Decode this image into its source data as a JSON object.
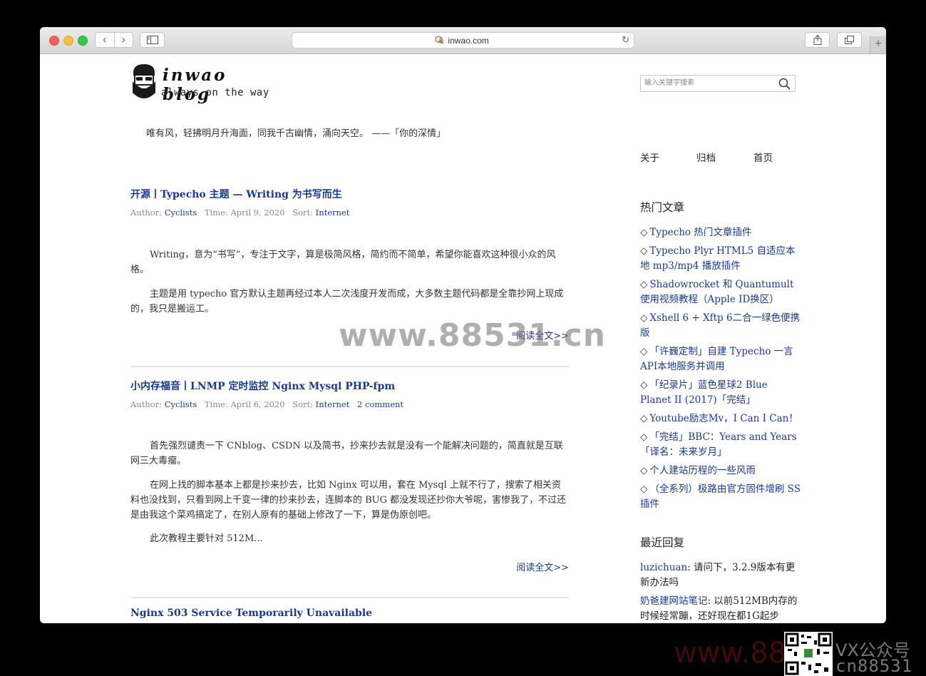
{
  "browser": {
    "url": "inwao.com",
    "back_label": "‹",
    "forward_label": "›",
    "new_tab_label": "+"
  },
  "site": {
    "logo_title": "inwao blog",
    "logo_subtitle": "always on the way",
    "tagline": "唯有风，轻拂明月升海面，同我千古幽情，涌向天空。 ——「你的深情」"
  },
  "posts": [
    {
      "title": "开源丨Typecho 主题 — Writing 为书写而生",
      "author_label": "Author:",
      "author": "Cyclists",
      "time_label": "Time:",
      "time": "April 9, 2020",
      "sort_label": "Sort:",
      "sort": "Internet",
      "paragraphs": [
        "Writing，意为“书写”，专注于文字，算是极简风格，简约而不简单，希望你能喜欢这种很小众的风格。",
        "主题是用 typecho 官方默认主题再经过本人二次浅度开发而成，大多数主题代码都是全靠抄网上现成的，我只是搬运工。"
      ],
      "readmore": "阅读全文>>"
    },
    {
      "title": "小内存福音丨LNMP 定时监控 Nginx Mysql PHP-fpm",
      "author_label": "Author:",
      "author": "Cyclists",
      "time_label": "Time:",
      "time": "April 6, 2020",
      "sort_label": "Sort:",
      "sort": "Internet",
      "comments": "2 comment",
      "paragraphs": [
        "首先强烈谴责一下 CNblog、CSDN 以及简书，抄来抄去就是没有一个能解决问题的，简直就是互联网三大毒瘤。",
        "在网上找的脚本基本上都是抄来抄去，比如 Nginx 可以用，套在 Mysql 上就不行了，搜索了相关资料也没找到，只看到网上千变一律的抄来抄去，连脚本的 BUG 都没发现还抄你大爷呢，害惨我了，不过还是由我这个菜鸡搞定了，在别人原有的基础上修改了一下，算是伪原创吧。",
        "此次教程主要针对 512M..."
      ],
      "readmore": "阅读全文>>"
    },
    {
      "title": "Nginx 503 Service Temporarily Unavailable"
    }
  ],
  "sidebar": {
    "search_placeholder": "输入关键字搜索",
    "nav": [
      "关于",
      "归档",
      "首页"
    ],
    "popular_title": "热门文章",
    "popular": [
      "Typecho 热门文章插件",
      "Typecho Plyr HTML5 自适应本地 mp3/mp4 播放插件",
      "Shadowrocket 和 Quantumult 使用视频教程（Apple ID换区）",
      "Xshell 6 + Xftp 6二合一绿色便携版",
      "「许巍定制」自建 Typecho 一言 API本地服务并调用",
      "「纪录片」蓝色星球2 Blue Planet II (2017)「完结」",
      "Youtube励志Mv，I Can I Can！",
      "「完结」BBC：Years and Years 「译名：未来岁月」",
      "个人建站历程的一些风雨",
      "（全系列）极路由官方固件增刷 SS 插件"
    ],
    "popular_bullet": "◇",
    "recent_title": "最近回复",
    "recent": [
      {
        "author": "luzichuan",
        "text": ": 请问下，3.2.9版本有更新办法吗"
      },
      {
        "author": "奶爸建网站笔记",
        "text": ": 以前512MB内存的时候经常蹦，还好现在都1G起步"
      }
    ]
  },
  "watermarks": {
    "center": "www.88531.cn",
    "corner": "www.885",
    "corner_label1": "VX公众号",
    "corner_label2": "cn88531"
  }
}
